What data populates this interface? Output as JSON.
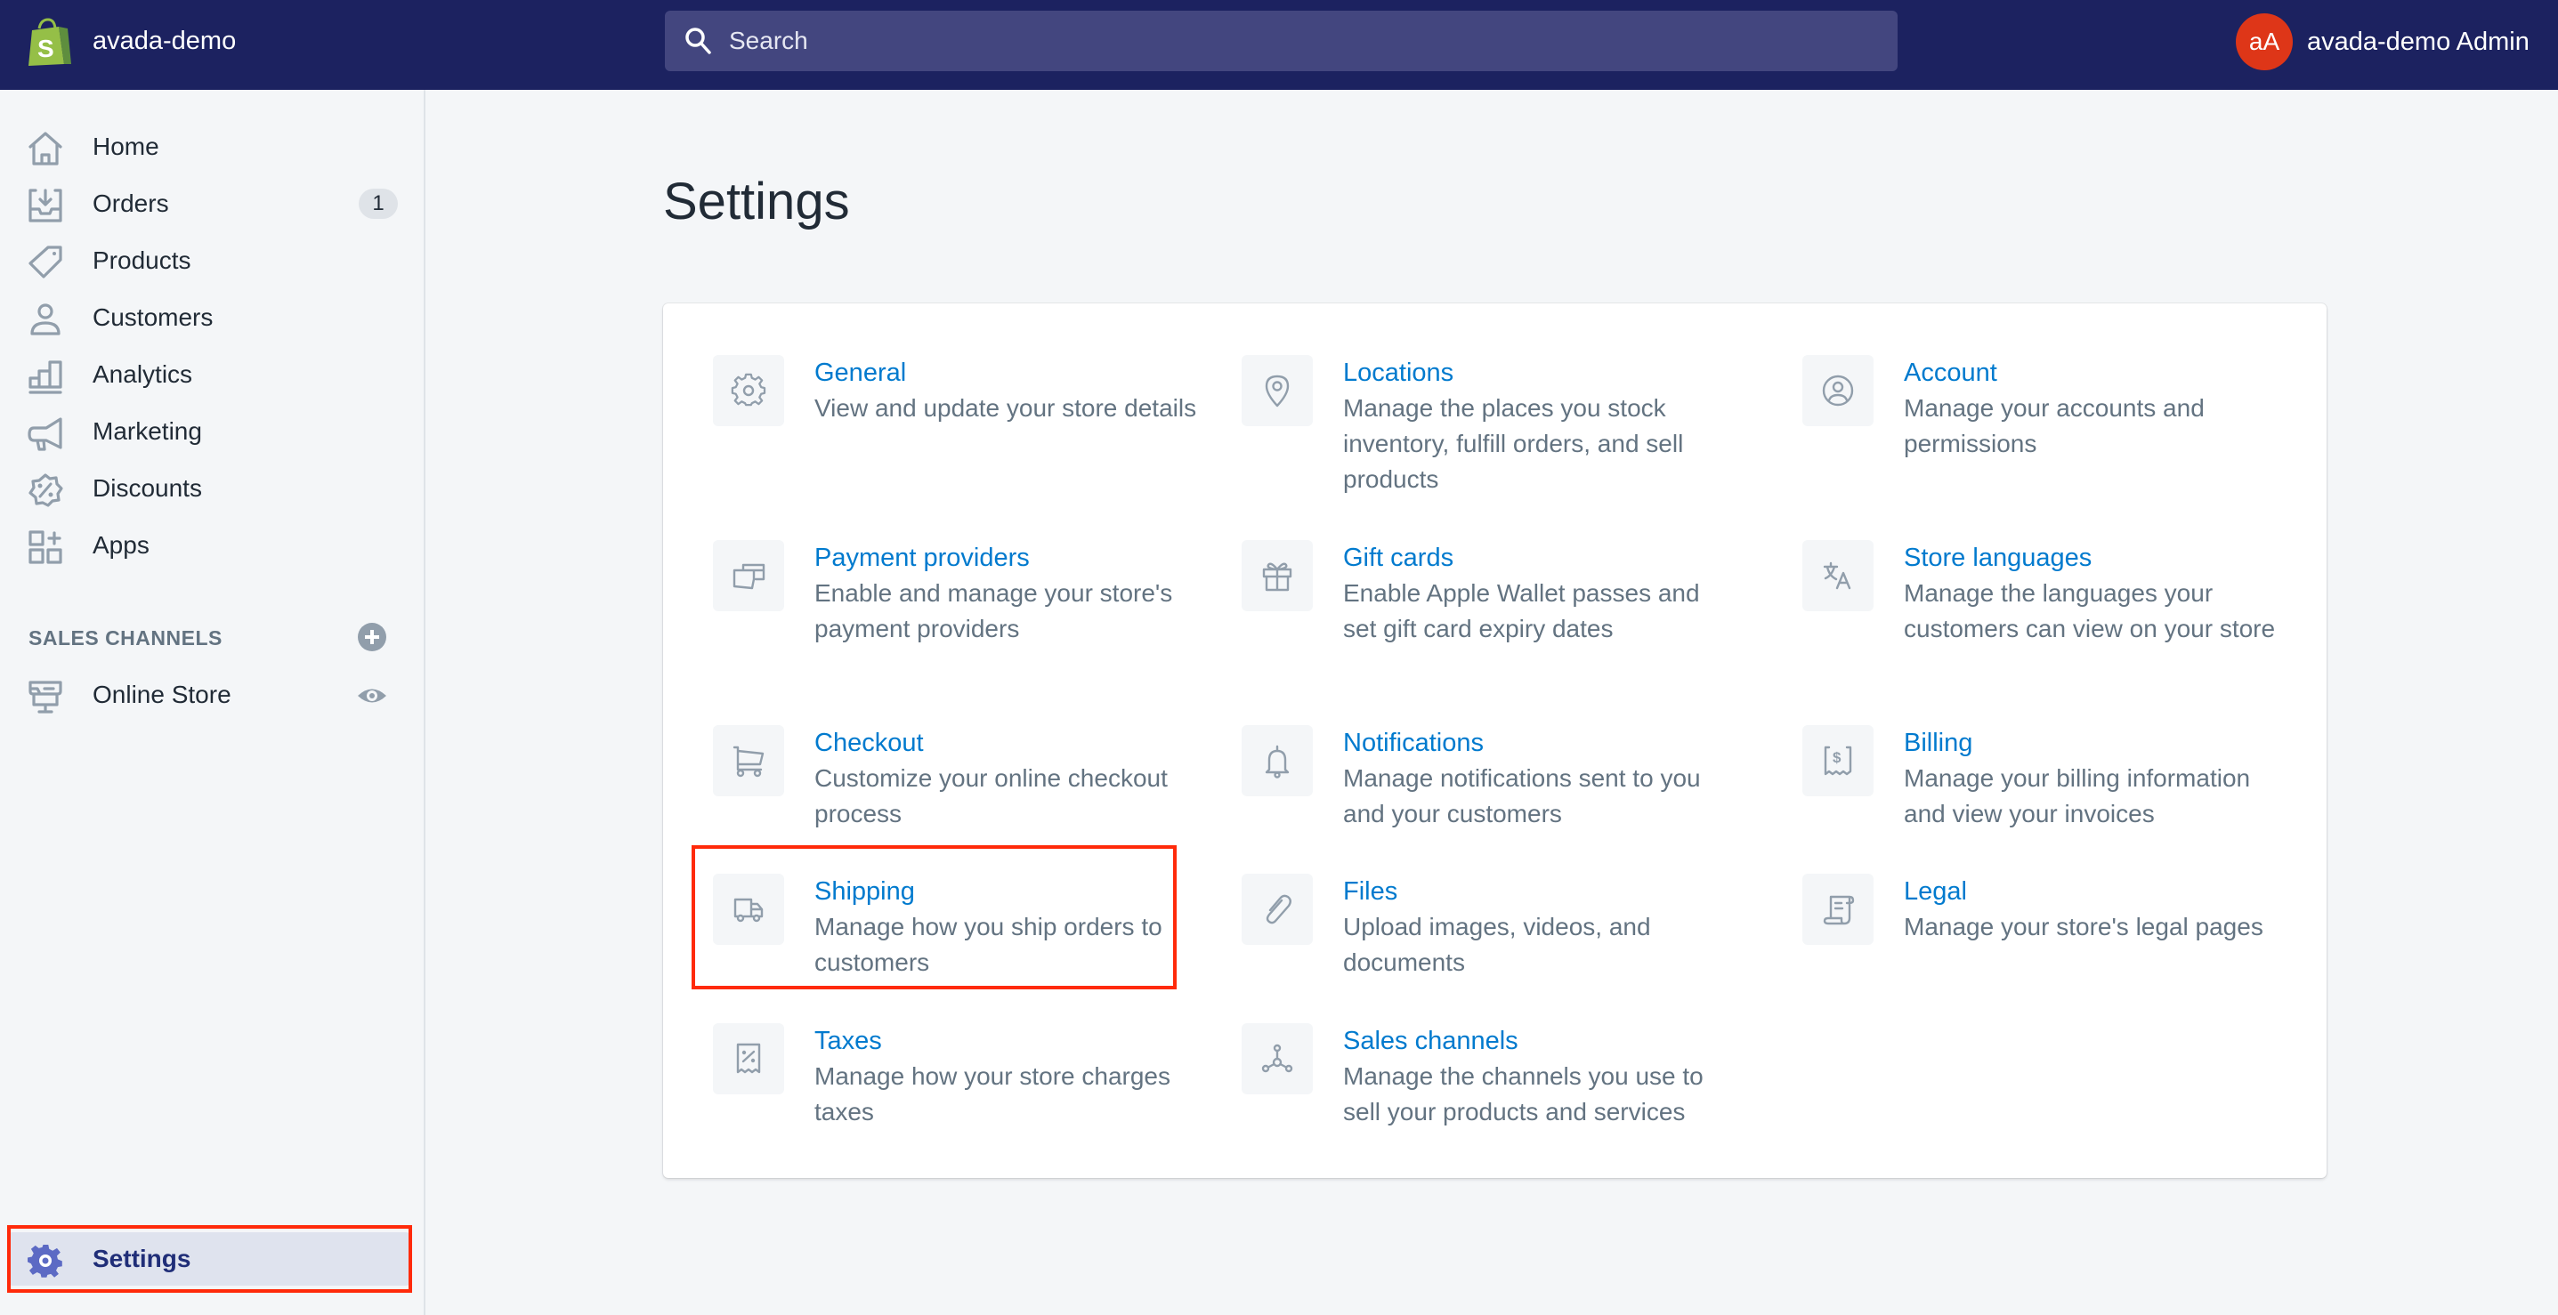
{
  "topbar": {
    "store_name": "avada-demo",
    "search_placeholder": "Search",
    "user_initials": "aA",
    "user_name": "avada-demo Admin",
    "colors": {
      "background": "#1c2260",
      "search": "#43467f",
      "avatar": "#de3618"
    }
  },
  "sidebar": {
    "items": [
      {
        "label": "Home",
        "icon": "home-icon"
      },
      {
        "label": "Orders",
        "icon": "orders-icon",
        "badge": "1"
      },
      {
        "label": "Products",
        "icon": "tag-icon"
      },
      {
        "label": "Customers",
        "icon": "person-icon"
      },
      {
        "label": "Analytics",
        "icon": "bar-chart-icon"
      },
      {
        "label": "Marketing",
        "icon": "megaphone-icon"
      },
      {
        "label": "Discounts",
        "icon": "discount-icon"
      },
      {
        "label": "Apps",
        "icon": "apps-icon"
      }
    ],
    "sales_channels_heading": "SALES CHANNELS",
    "channels": [
      {
        "label": "Online Store",
        "icon": "store-icon"
      }
    ],
    "settings_label": "Settings",
    "active_item": "Settings"
  },
  "main": {
    "title": "Settings",
    "settings": [
      {
        "title": "General",
        "description": "View and update your store details",
        "icon": "gear-icon"
      },
      {
        "title": "Locations",
        "description": "Manage the places you stock inventory, fulfill orders, and sell products",
        "icon": "location-pin-icon"
      },
      {
        "title": "Account",
        "description": "Manage your accounts and permissions",
        "icon": "account-circle-icon"
      },
      {
        "title": "Payment providers",
        "description": "Enable and manage your store's payment providers",
        "icon": "payment-icon"
      },
      {
        "title": "Gift cards",
        "description": "Enable Apple Wallet passes and set gift card expiry dates",
        "icon": "gift-icon"
      },
      {
        "title": "Store languages",
        "description": "Manage the languages your customers can view on your store",
        "icon": "translate-icon"
      },
      {
        "title": "Checkout",
        "description": "Customize your online checkout process",
        "icon": "cart-icon"
      },
      {
        "title": "Notifications",
        "description": "Manage notifications sent to you and your customers",
        "icon": "bell-icon"
      },
      {
        "title": "Billing",
        "description": "Manage your billing information and view your invoices",
        "icon": "billing-receipt-icon"
      },
      {
        "title": "Shipping",
        "description": "Manage how you ship orders to customers",
        "icon": "truck-icon"
      },
      {
        "title": "Files",
        "description": "Upload images, videos, and documents",
        "icon": "paperclip-icon"
      },
      {
        "title": "Legal",
        "description": "Manage your store's legal pages",
        "icon": "legal-scroll-icon"
      },
      {
        "title": "Taxes",
        "description": "Manage how your store charges taxes",
        "icon": "tax-receipt-icon"
      },
      {
        "title": "Sales channels",
        "description": "Manage the channels you use to sell your products and services",
        "icon": "sales-channels-icon"
      }
    ],
    "highlighted": [
      "Shipping",
      "Settings"
    ],
    "colors": {
      "link": "#007ace",
      "description": "#637381",
      "highlight": "#ff2a0a"
    }
  }
}
